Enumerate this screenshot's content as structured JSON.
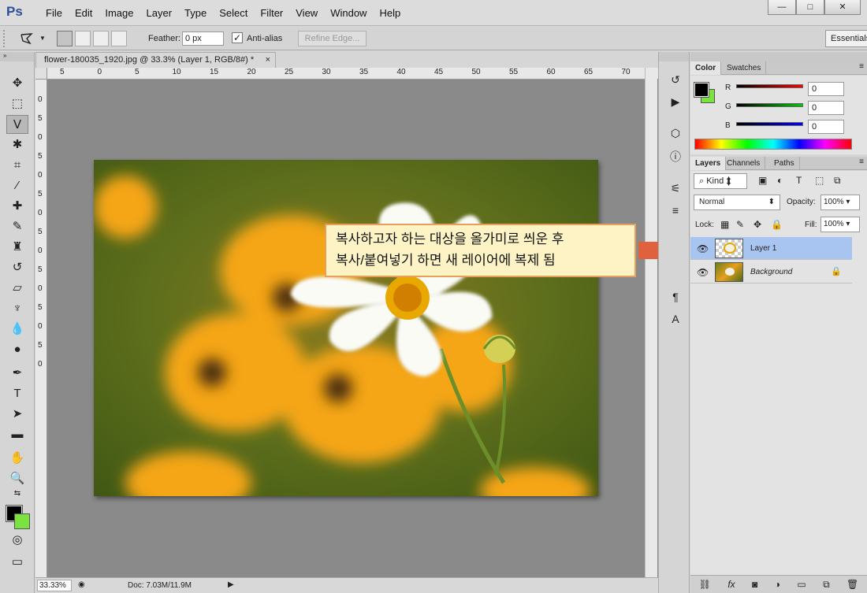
{
  "app": {
    "logo": "Ps"
  },
  "menu": [
    "File",
    "Edit",
    "Image",
    "Layer",
    "Type",
    "Select",
    "Filter",
    "View",
    "Window",
    "Help"
  ],
  "window_controls": {
    "minimize": "—",
    "maximize": "□",
    "close": "✕"
  },
  "options": {
    "feather_label": "Feather:",
    "feather_value": "0 px",
    "antialias_label": "Anti-alias",
    "antialias_checked": true,
    "refine_label": "Refine Edge...",
    "workspace": "Essentials"
  },
  "document": {
    "tab_title": "flower-180035_1920.jpg @ 33.3% (Layer 1, RGB/8#) *",
    "close": "×",
    "ruler_ticks": [
      "5",
      "0",
      "5",
      "10",
      "15",
      "20",
      "25",
      "30",
      "35",
      "40",
      "45",
      "50",
      "55",
      "60",
      "65",
      "70"
    ],
    "ruler_v_ticks": [
      "0",
      "5",
      "0",
      "5",
      "0",
      "5",
      "0",
      "5",
      "0",
      "5",
      "0",
      "5",
      "0",
      "5",
      "0"
    ]
  },
  "callout": {
    "line1": "복사하고자 하는 대상을 올가미로 씌운 후",
    "line2": "복사/붙여넣기 하면 새 레이어에 복제 됨"
  },
  "status": {
    "zoom": "33.33%",
    "doc": "Doc: 7.03M/11.9M"
  },
  "color_panel": {
    "tabs": [
      "Color",
      "Swatches"
    ],
    "r_label": "R",
    "g_label": "G",
    "b_label": "B",
    "r": "0",
    "g": "0",
    "b": "0",
    "foreground": "#000000",
    "background": "#7be340"
  },
  "layers_panel": {
    "tabs": [
      "Layers",
      "Channels",
      "Paths"
    ],
    "kind": "Kind",
    "blend_mode": "Normal",
    "opacity_label": "Opacity:",
    "opacity": "100%",
    "lock_label": "Lock:",
    "fill_label": "Fill:",
    "fill": "100%",
    "layers": [
      {
        "name": "Layer 1",
        "selected": true
      },
      {
        "name": "Background",
        "selected": false,
        "locked": true
      }
    ]
  }
}
